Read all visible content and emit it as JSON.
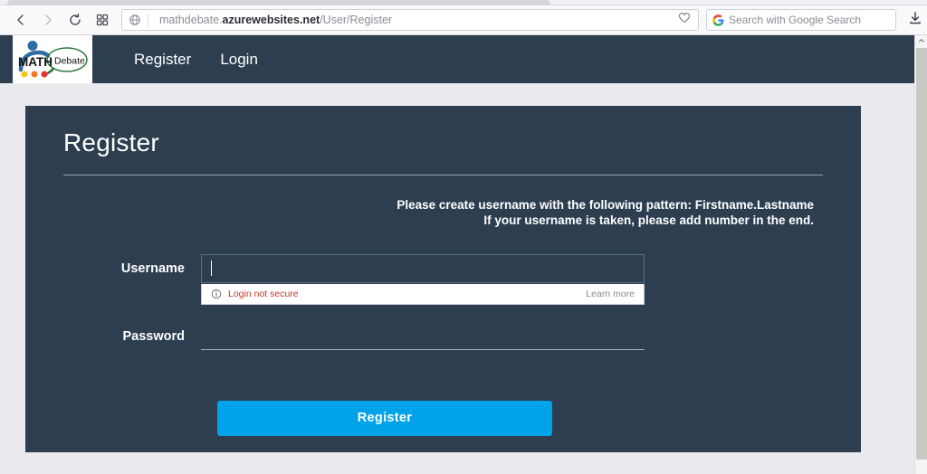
{
  "browser": {
    "back_icon": "chevron-left-icon",
    "forward_icon": "chevron-right-icon",
    "reload_icon": "reload-icon",
    "apps_icon": "grid-apps-icon",
    "globe_icon": "globe-icon",
    "url_prefix": "mathdebate.",
    "url_host": "azurewebsites.net",
    "url_path": "/User/Register",
    "full_url": "mathdebate.azurewebsites.net/User/Register",
    "bookmark_icon": "heart-outline-icon",
    "search_placeholder": "Search with Google Search",
    "search_engine_icon": "google-g-icon",
    "download_icon": "download-icon"
  },
  "navbar": {
    "brand": {
      "icon": "math-debate-logo-icon",
      "math_text": "MATH",
      "debate_text": "Debate"
    },
    "links": [
      {
        "label": "Register"
      },
      {
        "label": "Login"
      }
    ]
  },
  "card": {
    "title": "Register",
    "instructions_line1": "Please create username with the following pattern: Firstname.Lastname",
    "instructions_line2": "If your username is taken, please add number in the end.",
    "fields": [
      {
        "label": "Username",
        "value": "",
        "placeholder": ""
      },
      {
        "label": "Password",
        "value": "",
        "placeholder": ""
      }
    ],
    "submit_label": "Register"
  },
  "insecure_popup": {
    "icon": "info-circle-icon",
    "message": "Login not secure",
    "link_label": "Learn more"
  },
  "scrollbar": {
    "up_arrow_icon": "chevron-up-icon"
  },
  "colors": {
    "navy": "#2c3e50",
    "accent_blue": "#00a2e8",
    "page_bg": "#eaeaee",
    "warning_red": "#c0392b"
  }
}
